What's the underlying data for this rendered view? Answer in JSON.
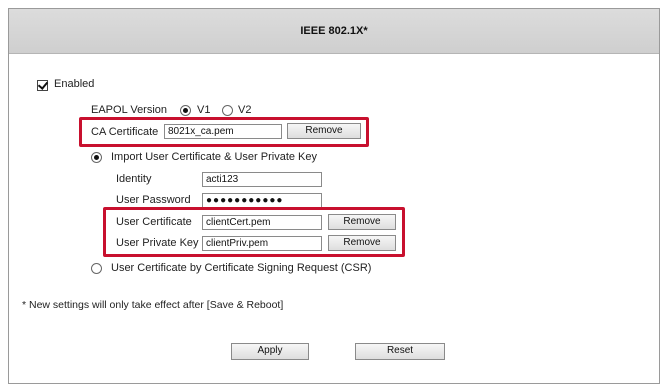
{
  "header": {
    "title": "IEEE 802.1X*"
  },
  "enabled": {
    "label": "Enabled",
    "checked": true
  },
  "eapol": {
    "label": "EAPOL Version",
    "v1": "V1",
    "v2": "V2",
    "selected": "V1"
  },
  "ca_cert": {
    "label": "CA Certificate",
    "value": "8021x_ca.pem",
    "remove": "Remove"
  },
  "import_option": {
    "label": "Import User Certificate & User Private Key",
    "selected": true
  },
  "identity": {
    "label": "Identity",
    "value": "acti123"
  },
  "password": {
    "label": "User Password",
    "value": "●●●●●●●●●●●"
  },
  "user_cert": {
    "label": "User Certificate",
    "value": "clientCert.pem",
    "remove": "Remove"
  },
  "user_key": {
    "label": "User Private Key",
    "value": "clientPriv.pem",
    "remove": "Remove"
  },
  "csr_option": {
    "label": "User Certificate by Certificate Signing Request (CSR)",
    "selected": false
  },
  "note": "* New settings will only take effect after [Save & Reboot]",
  "actions": {
    "apply": "Apply",
    "reset": "Reset"
  },
  "colors": {
    "highlight": "#c8102e",
    "header_bg": "#d6d6d6"
  }
}
